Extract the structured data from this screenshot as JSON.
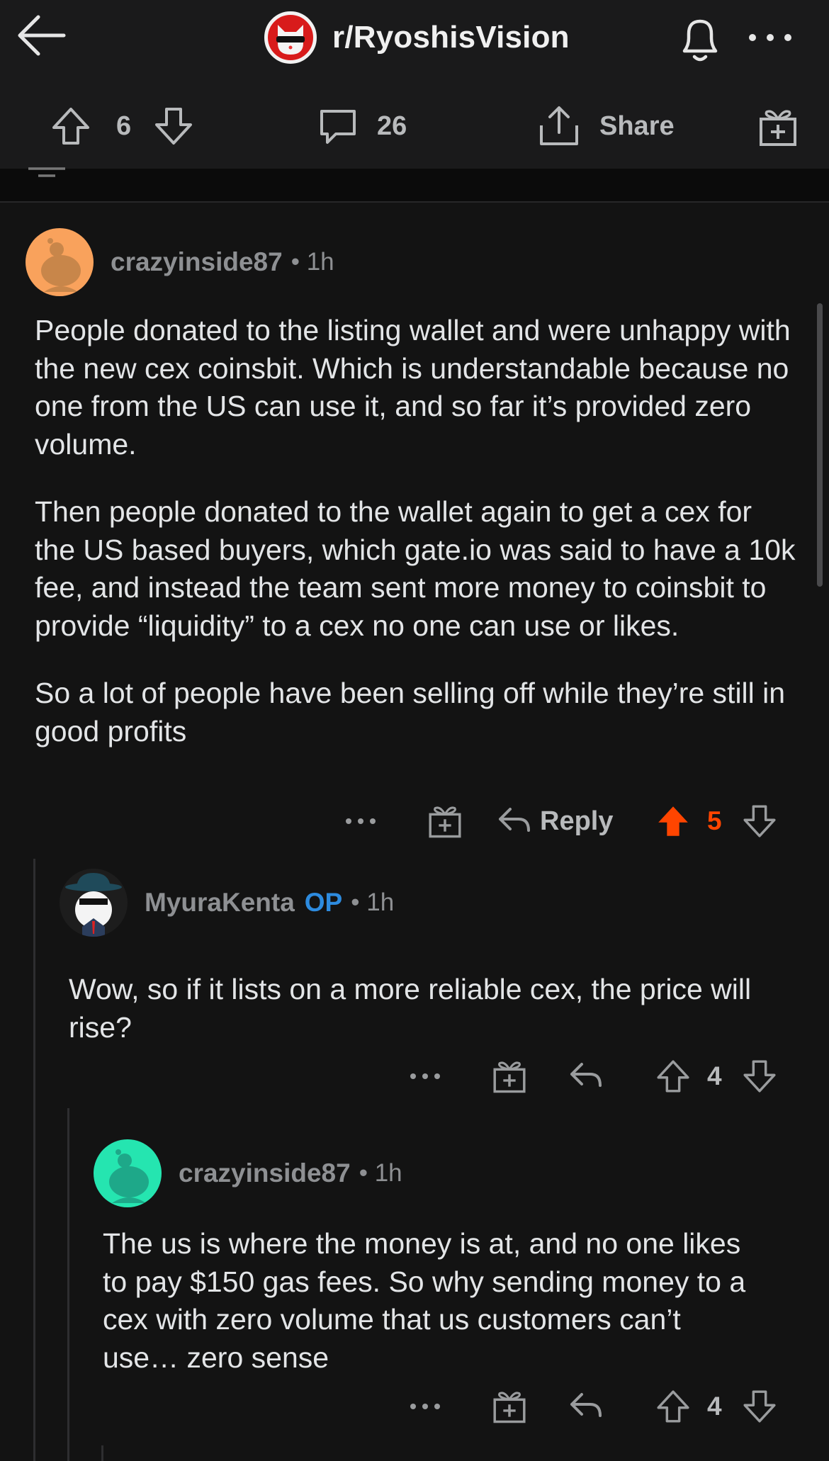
{
  "header": {
    "subreddit": "r/RyoshisVision",
    "back_icon": "arrow-left-icon",
    "bell_icon": "bell-icon",
    "more_icon": "more-horizontal-icon"
  },
  "post_actions": {
    "upvotes": "6",
    "comments": "26",
    "share_label": "Share"
  },
  "colors": {
    "background": "#131313",
    "upvote_active": "#ff4500",
    "op_badge": "#2d8bdf"
  },
  "comments": [
    {
      "username": "crazyinside87",
      "time": "1h",
      "paragraphs": [
        "People donated to the listing wallet and were unhappy with the new cex coinsbit. Which is understandable because no one from the US can use it, and so far it’s provided zero volume.",
        "Then people donated to the wallet again to get a cex for the US based buyers, which gate.io was said to have a 10k fee, and instead the team sent more money to coinsbit to provide “liquidity” to a cex no one can use or likes.",
        "So a lot of people have been selling off while they’re still in good profits"
      ],
      "reply_label": "Reply",
      "score": "5",
      "upvoted": true
    },
    {
      "username": "MyuraKenta",
      "op_badge": "OP",
      "time": "1h",
      "paragraphs": [
        "Wow, so if it lists on a more reliable cex, the price will rise?"
      ],
      "score": "4"
    },
    {
      "username": "crazyinside87",
      "time": "1h",
      "paragraphs": [
        "The us is where the money is at, and no one likes to pay $150 gas fees. So why sending money to a cex with zero volume that us customers can’t use… zero sense"
      ],
      "score": "4"
    }
  ]
}
